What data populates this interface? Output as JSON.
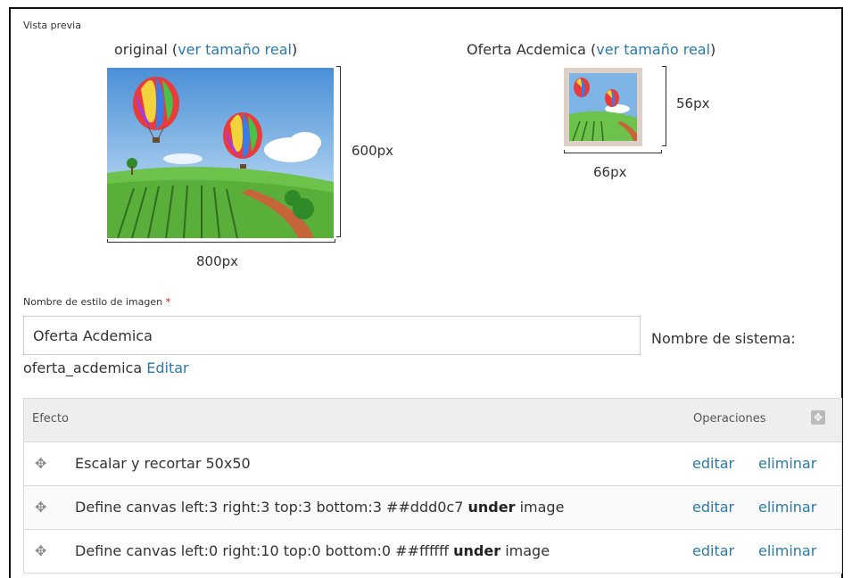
{
  "preview": {
    "section_label": "Vista previa",
    "original": {
      "label": "original",
      "open_paren": "(",
      "link": "ver tamaño real",
      "close_paren": ")",
      "width_label": "800px",
      "height_label": "600px"
    },
    "derivative": {
      "label": "Oferta Acdemica",
      "open_paren": "(",
      "link": "ver tamaño real",
      "close_paren": ")",
      "width_label": "66px",
      "height_label": "56px"
    },
    "colors": {
      "frame_border": "#ddd0c7"
    }
  },
  "form": {
    "name_label": "Nombre de estilo de imagen",
    "required_mark": "*",
    "name_value": "Oferta Acdemica",
    "machine_name_label": "Nombre de sistema:",
    "machine_name_value": "oferta_acdemica",
    "machine_name_edit": "Editar"
  },
  "effects_table": {
    "header_effect": "Efecto",
    "header_operations": "Operaciones",
    "header_icon": "move-icon",
    "rows": [
      {
        "drag_icon": "drag-handle-icon",
        "text_before": "Escalar y recortar 50x50",
        "bold": "",
        "text_after": "",
        "edit": "editar",
        "delete": "eliminar"
      },
      {
        "drag_icon": "drag-handle-icon",
        "text_before": "Define canvas left:3 right:3 top:3 bottom:3  ##ddd0c7 ",
        "bold": "under",
        "text_after": " image",
        "edit": "editar",
        "delete": "eliminar"
      },
      {
        "drag_icon": "drag-handle-icon",
        "text_before": "Define canvas left:0 right:10 top:0 bottom:0  ##ffffff ",
        "bold": "under",
        "text_after": " image",
        "edit": "editar",
        "delete": "eliminar"
      }
    ]
  }
}
